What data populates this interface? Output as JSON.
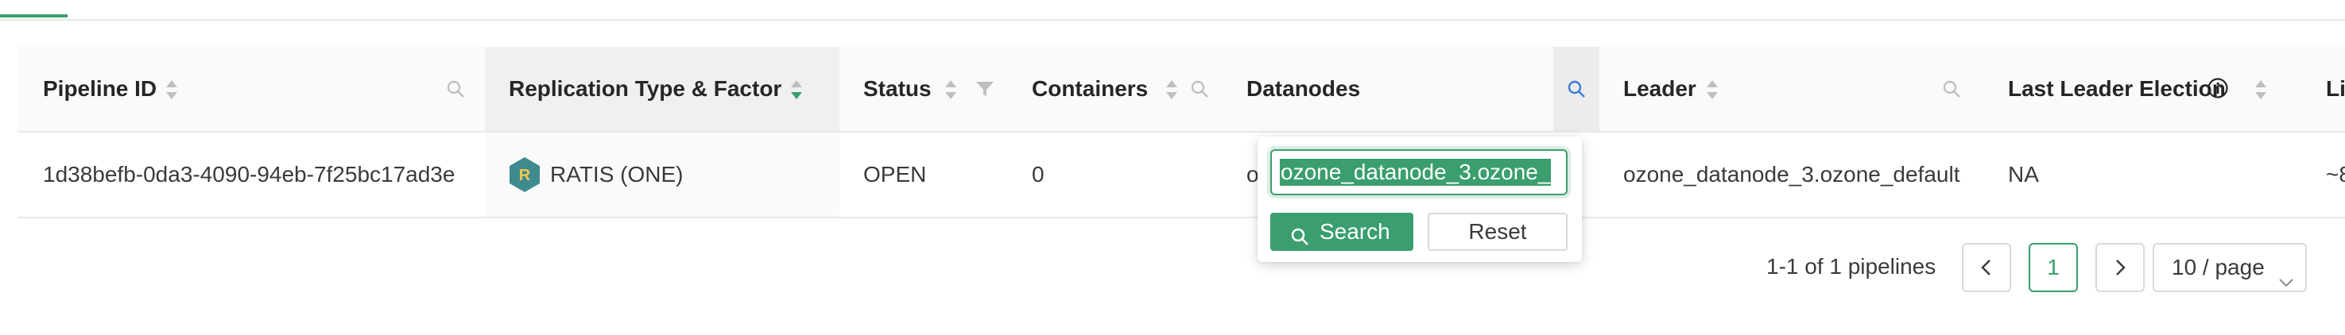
{
  "table": {
    "columns": [
      {
        "key": "pipeline_id",
        "label": "Pipeline ID"
      },
      {
        "key": "replication",
        "label": "Replication Type & Factor"
      },
      {
        "key": "status",
        "label": "Status"
      },
      {
        "key": "containers",
        "label": "Containers"
      },
      {
        "key": "datanodes",
        "label": "Datanodes"
      },
      {
        "key": "leader",
        "label": "Leader"
      },
      {
        "key": "last_leader_election",
        "label": "Last Leader Election"
      },
      {
        "key": "truncated_col",
        "label": "Li"
      }
    ],
    "rows": [
      {
        "pipeline_id": "1d38befb-0da3-4090-94eb-7f25bc17ad3e",
        "replication_badge": "R",
        "replication": "RATIS (ONE)",
        "status": "OPEN",
        "containers": "0",
        "datanodes": "ozo",
        "leader": "ozone_datanode_3.ozone_default",
        "last_leader_election": "NA",
        "truncated_col": "~8"
      }
    ]
  },
  "filter_dropdown": {
    "input_value": "ozone_datanode_3.ozone_",
    "search_label": "Search",
    "reset_label": "Reset"
  },
  "pagination": {
    "summary": "1-1 of 1 pipelines",
    "prev": "<",
    "current_page": "1",
    "next": ">",
    "page_size": "10 / page"
  },
  "colors": {
    "accent": "#3a9e6e",
    "header_bg": "#fafafa",
    "border": "#e8e8e8"
  }
}
